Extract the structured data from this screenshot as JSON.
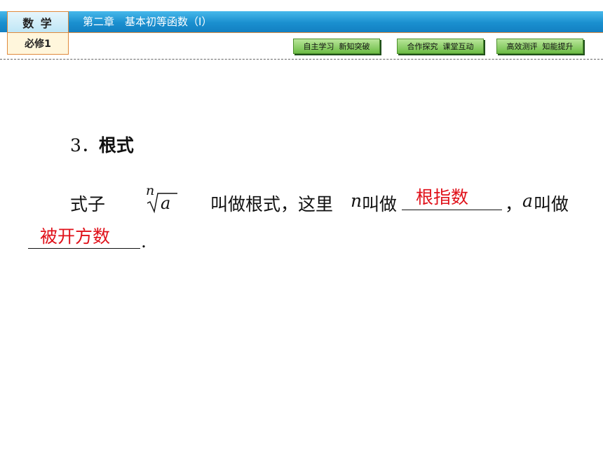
{
  "header": {
    "subject": "数 学",
    "book": "必修1",
    "chapter": "第二章　基本初等函数（Ⅰ）",
    "nav": [
      {
        "label": "自主学习  新知突破"
      },
      {
        "label": "合作探究  课堂互动"
      },
      {
        "label": "高效测评  知能提升"
      }
    ]
  },
  "content": {
    "heading_num": "3．",
    "heading_text": "根式",
    "expr_prefix": "式子",
    "radical_index": "n",
    "radical_body": "a",
    "text_mid1": "叫做根式，这里",
    "var_n": "n",
    "text_mid2": "叫做",
    "answer1": "根指数",
    "text_mid3": "，",
    "var_a": "a",
    "text_mid4": "叫做",
    "answer2": "被开方数",
    "end_punct": "."
  }
}
